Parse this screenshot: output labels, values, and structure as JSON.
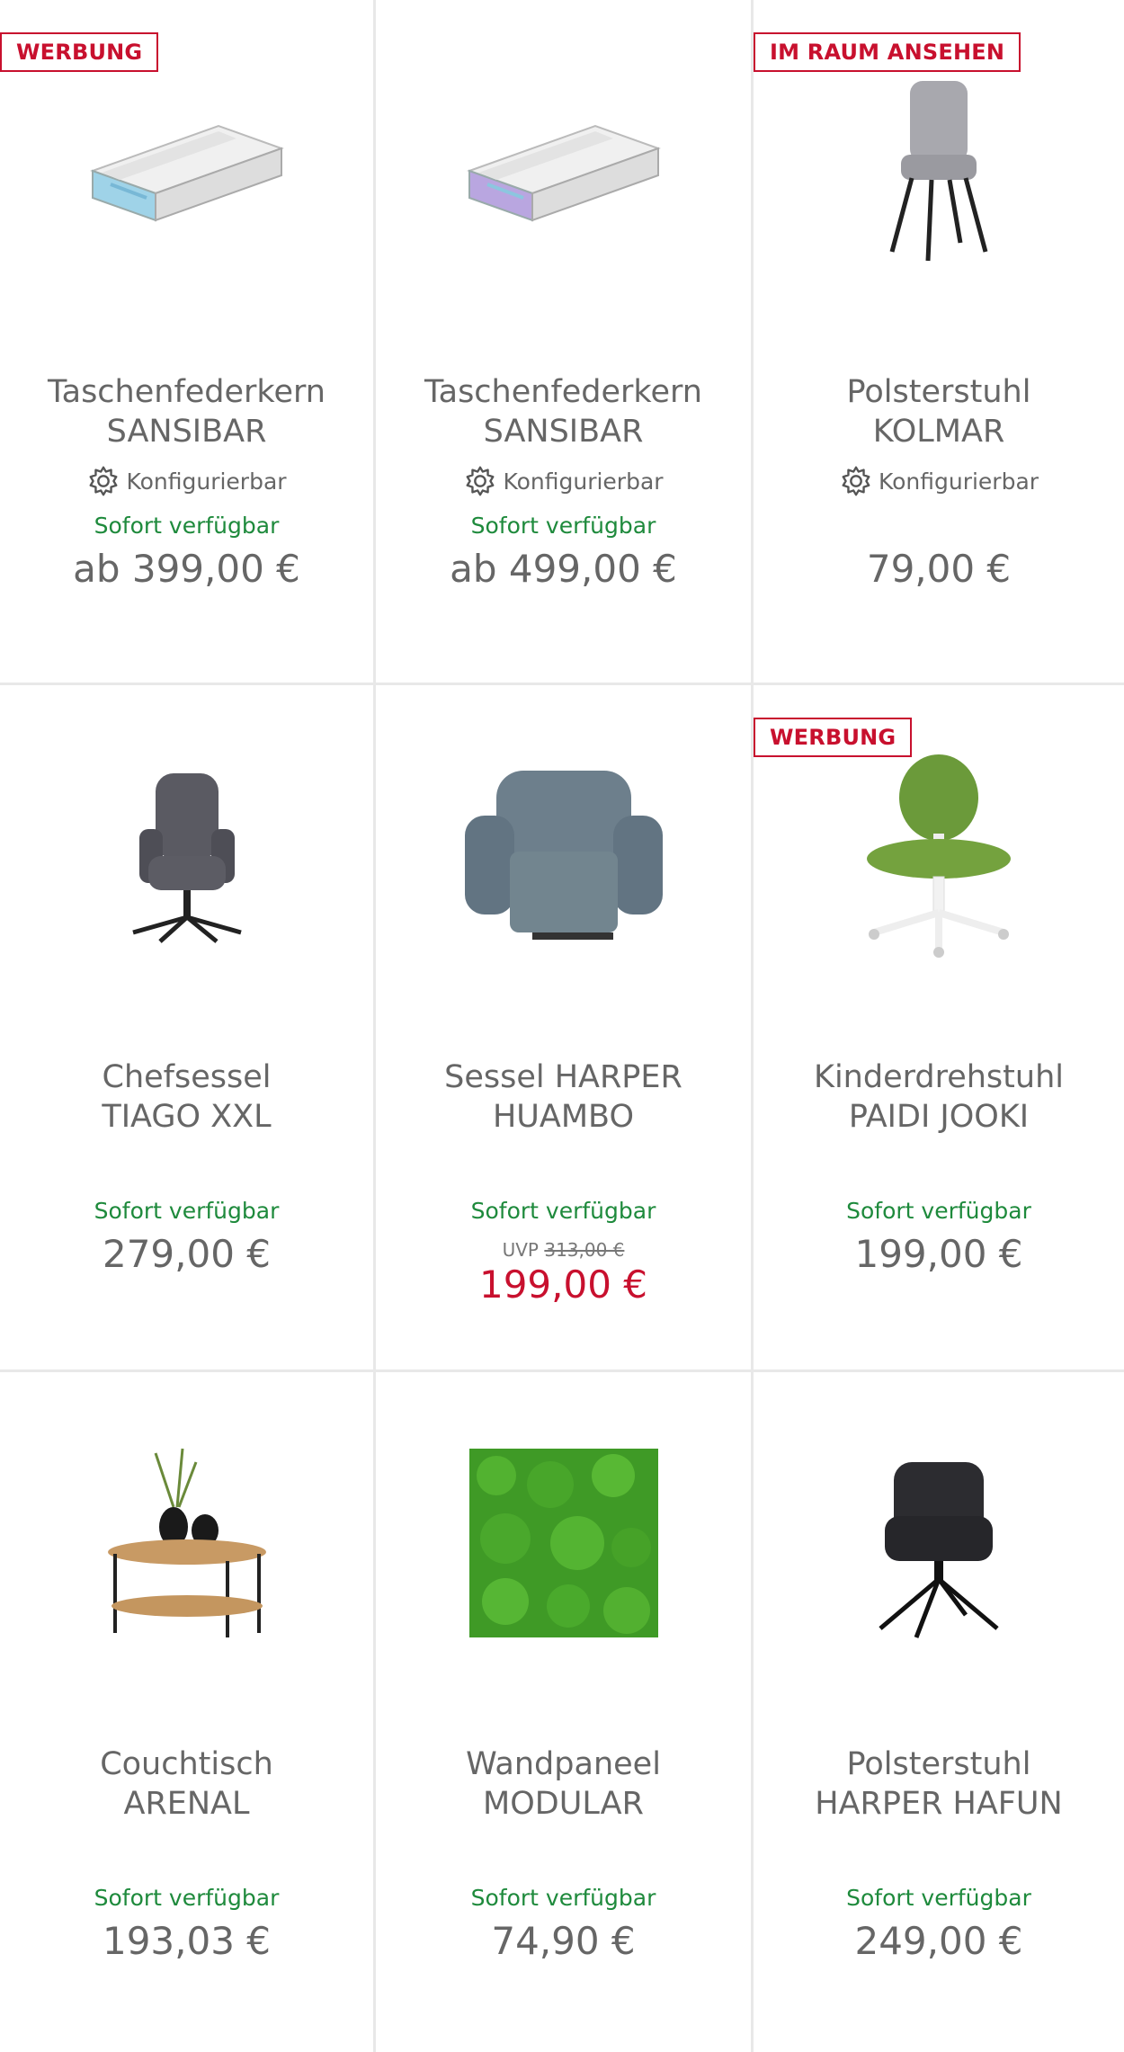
{
  "products": [
    {
      "badge": "WERBUNG",
      "name_line1": "Taschenfederkern",
      "name_line2": "SANSIBAR",
      "configurable": "Konfigurierbar",
      "availability": "Sofort verfügbar",
      "price": "ab 399,00 €",
      "image_icon": "mattress-blue-image"
    },
    {
      "badge": "",
      "name_line1": "Taschenfederkern",
      "name_line2": "SANSIBAR",
      "configurable": "Konfigurierbar",
      "availability": "Sofort verfügbar",
      "price": "ab 499,00 €",
      "image_icon": "mattress-purple-image"
    },
    {
      "badge": "IM RAUM ANSEHEN",
      "name_line1": "Polsterstuhl",
      "name_line2": "KOLMAR",
      "configurable": "Konfigurierbar",
      "availability": "",
      "price": "79,00 €",
      "image_icon": "grey-chair-image"
    },
    {
      "badge": "",
      "name_line1": "Chefsessel",
      "name_line2": "TIAGO XXL",
      "configurable": "",
      "availability": "Sofort verfügbar",
      "price": "279,00 €",
      "image_icon": "office-chair-image"
    },
    {
      "badge": "",
      "name_line1": "Sessel HARPER",
      "name_line2": "HUAMBO",
      "configurable": "",
      "availability": "Sofort verfügbar",
      "uvp_label": "UVP",
      "uvp_price": "313,00 €",
      "price": "199,00 €",
      "image_icon": "recliner-image"
    },
    {
      "badge": "WERBUNG",
      "name_line1": "Kinderdrehstuhl",
      "name_line2": "PAIDI JOOKI",
      "configurable": "",
      "availability": "Sofort verfügbar",
      "price": "199,00 €",
      "image_icon": "kids-chair-image"
    },
    {
      "badge": "",
      "name_line1": "Couchtisch",
      "name_line2": "ARENAL",
      "configurable": "",
      "availability": "Sofort verfügbar",
      "price": "193,03 €",
      "image_icon": "coffee-table-image"
    },
    {
      "badge": "",
      "name_line1": "Wandpaneel",
      "name_line2": "MODULAR",
      "configurable": "",
      "availability": "Sofort verfügbar",
      "price": "74,90 €",
      "image_icon": "moss-panel-image"
    },
    {
      "badge": "",
      "name_line1": "Polsterstuhl",
      "name_line2": "HARPER HAFUN",
      "configurable": "",
      "availability": "Sofort verfügbar",
      "price": "249,00 €",
      "image_icon": "black-chair-image"
    }
  ],
  "colors": {
    "badge_red": "#c8102e",
    "available_green": "#1e8a3c",
    "sale_red": "#c8102e",
    "text_grey": "#666666",
    "divider": "#e8e8e8"
  }
}
